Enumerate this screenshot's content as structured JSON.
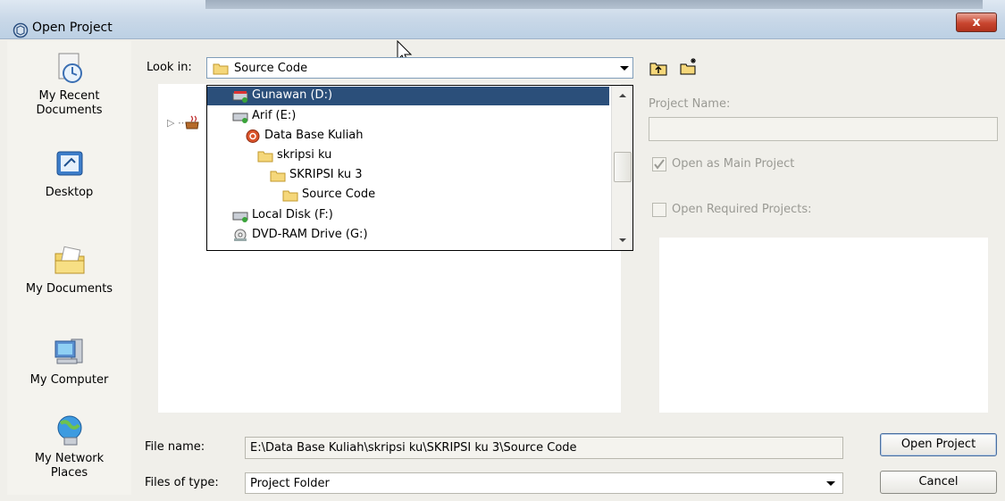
{
  "window": {
    "title": "Open Project",
    "close_label": "x"
  },
  "places": [
    {
      "label1": "My Recent",
      "label2": "Documents",
      "icon": "recent-documents-icon"
    },
    {
      "label1": "Desktop",
      "label2": "",
      "icon": "desktop-icon"
    },
    {
      "label1": "My Documents",
      "label2": "",
      "icon": "my-documents-icon"
    },
    {
      "label1": "My Computer",
      "label2": "",
      "icon": "my-computer-icon"
    },
    {
      "label1": "My Network",
      "label2": "Places",
      "icon": "network-places-icon"
    }
  ],
  "look_in": {
    "label": "Look in:",
    "value": "Source Code"
  },
  "dropdown": {
    "items": [
      {
        "label": "Gunawan (D:)",
        "icon": "drive-icon",
        "selected": true
      },
      {
        "label": "Arif (E:)",
        "icon": "drive-icon",
        "selected": false
      },
      {
        "label": "Data Base Kuliah",
        "icon": "project-icon",
        "selected": false
      },
      {
        "label": "skripsi ku",
        "icon": "folder-icon",
        "selected": false
      },
      {
        "label": "SKRIPSI ku 3",
        "icon": "folder-icon",
        "selected": false
      },
      {
        "label": "Source Code",
        "icon": "folder-icon",
        "selected": false
      },
      {
        "label": "Local Disk (F:)",
        "icon": "drive-icon",
        "selected": false
      },
      {
        "label": "DVD-RAM Drive (G:)",
        "icon": "dvd-drive-icon",
        "selected": false
      }
    ]
  },
  "right_panel": {
    "project_name_label": "Project Name:",
    "open_main_label": "Open as Main Project",
    "open_main_checked": true,
    "open_required_label": "Open Required Projects:",
    "open_required_checked": false
  },
  "file_name": {
    "label": "File name:",
    "value": "E:\\Data Base Kuliah\\skripsi ku\\SKRIPSI ku 3\\Source Code"
  },
  "files_of_type": {
    "label": "Files of type:",
    "value": "Project Folder"
  },
  "buttons": {
    "open": "Open Project",
    "cancel": "Cancel"
  },
  "colors": {
    "selection": "#2b4f7a",
    "title_gradient": "#c9d8e8",
    "close": "#c8452f"
  }
}
